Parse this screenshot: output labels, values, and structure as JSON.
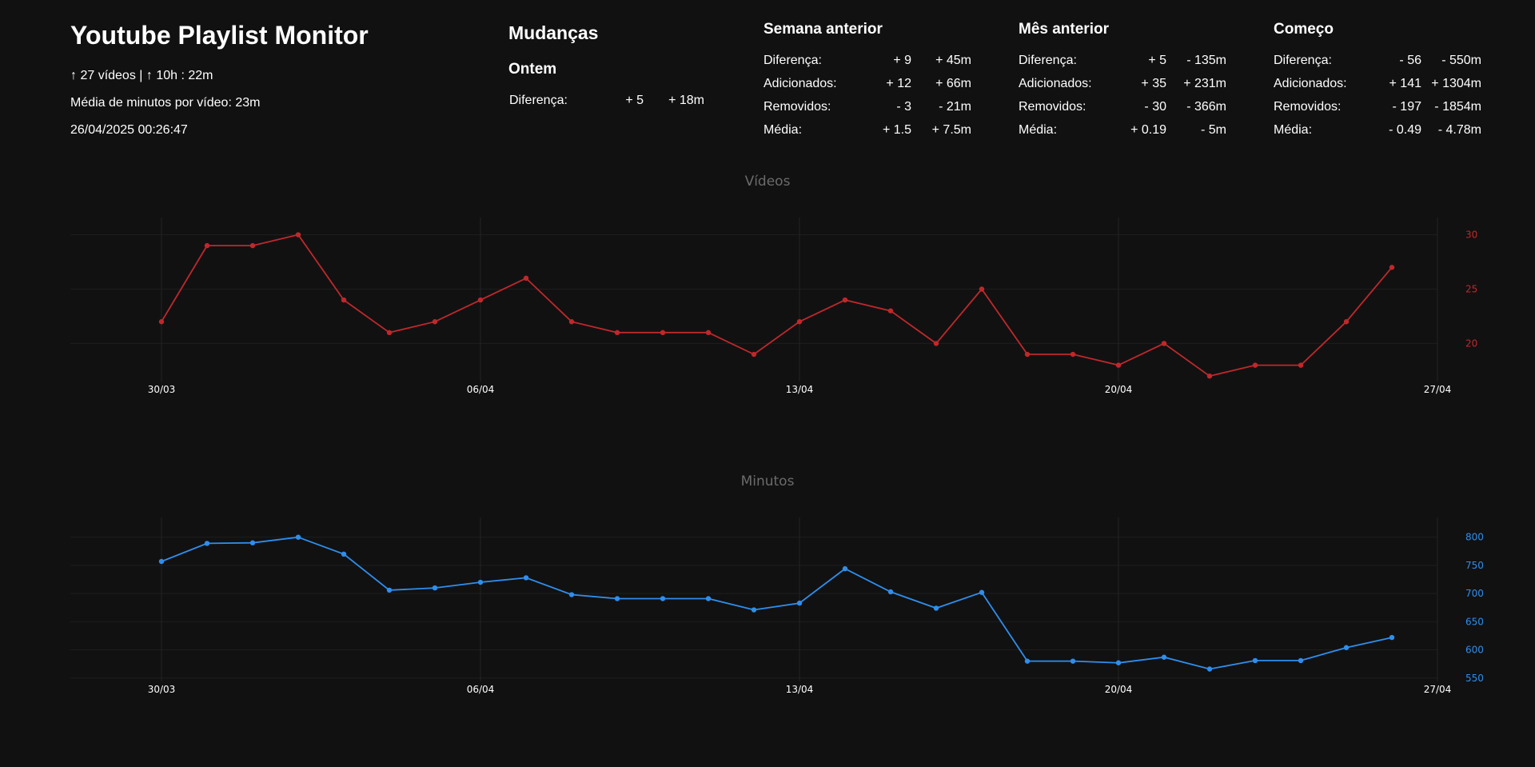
{
  "header": {
    "title": "Youtube Playlist Monitor",
    "summary": "↑ 27 vídeos | ↑ 10h : 22m",
    "average": "Média de minutos por vídeo: 23m",
    "timestamp": "26/04/2025 00:26:47"
  },
  "changes": {
    "title": "Mudanças",
    "yesterday": {
      "title": "Ontem",
      "rows": [
        {
          "label": "Diferença:",
          "count": "+ 5",
          "minutes": "+ 18m"
        }
      ]
    },
    "last_week": {
      "title": "Semana anterior",
      "rows": [
        {
          "label": "Diferença:",
          "count": "+ 9",
          "minutes": "+ 45m"
        },
        {
          "label": "Adicionados:",
          "count": "+ 12",
          "minutes": "+ 66m"
        },
        {
          "label": "Removidos:",
          "count": "- 3",
          "minutes": "- 21m"
        },
        {
          "label": "Média:",
          "count": "+ 1.5",
          "minutes": "+ 7.5m"
        }
      ]
    },
    "last_month": {
      "title": "Mês anterior",
      "rows": [
        {
          "label": "Diferença:",
          "count": "+ 5",
          "minutes": "- 135m"
        },
        {
          "label": "Adicionados:",
          "count": "+ 35",
          "minutes": "+ 231m"
        },
        {
          "label": "Removidos:",
          "count": "- 30",
          "minutes": "- 366m"
        },
        {
          "label": "Média:",
          "count": "+ 0.19",
          "minutes": "- 5m"
        }
      ]
    },
    "start": {
      "title": "Começo",
      "rows": [
        {
          "label": "Diferença:",
          "count": "- 56",
          "minutes": "- 550m"
        },
        {
          "label": "Adicionados:",
          "count": "+ 141",
          "minutes": "+ 1304m"
        },
        {
          "label": "Removidos:",
          "count": "- 197",
          "minutes": "- 1854m"
        },
        {
          "label": "Média:",
          "count": "- 0.49",
          "minutes": "- 4.78m"
        }
      ]
    }
  },
  "chart_data": [
    {
      "type": "line",
      "title": "Vídeos",
      "color": "#c0282b",
      "x": [
        "2025-03-30",
        "2025-03-31",
        "2025-04-01",
        "2025-04-02",
        "2025-04-03",
        "2025-04-04",
        "2025-04-05",
        "2025-04-06",
        "2025-04-07",
        "2025-04-08",
        "2025-04-09",
        "2025-04-10",
        "2025-04-11",
        "2025-04-12",
        "2025-04-13",
        "2025-04-14",
        "2025-04-15",
        "2025-04-16",
        "2025-04-17",
        "2025-04-18",
        "2025-04-19",
        "2025-04-20",
        "2025-04-21",
        "2025-04-22",
        "2025-04-23",
        "2025-04-24",
        "2025-04-25",
        "2025-04-26"
      ],
      "y": [
        22,
        29,
        29,
        30,
        24,
        21,
        22,
        24,
        26,
        22,
        21,
        21,
        21,
        19,
        22,
        24,
        23,
        20,
        25,
        19,
        19,
        18,
        20,
        17,
        18,
        18,
        22,
        27
      ],
      "xticks": [
        "30/03",
        "06/04",
        "13/04",
        "20/04",
        "27/04"
      ],
      "xtick_dates": [
        "2025-03-30",
        "2025-04-06",
        "2025-04-13",
        "2025-04-20",
        "2025-04-27"
      ],
      "xlim": [
        "2025-03-28",
        "2025-04-27"
      ],
      "yticks": [
        20,
        25,
        30
      ],
      "ylim": [
        16.5,
        30.7
      ],
      "y_axis_side": "right",
      "grid": true
    },
    {
      "type": "line",
      "title": "Minutos",
      "color": "#2f8eec",
      "x": [
        "2025-03-30",
        "2025-03-31",
        "2025-04-01",
        "2025-04-02",
        "2025-04-03",
        "2025-04-04",
        "2025-04-05",
        "2025-04-06",
        "2025-04-07",
        "2025-04-08",
        "2025-04-09",
        "2025-04-10",
        "2025-04-11",
        "2025-04-12",
        "2025-04-13",
        "2025-04-14",
        "2025-04-15",
        "2025-04-16",
        "2025-04-17",
        "2025-04-18",
        "2025-04-19",
        "2025-04-20",
        "2025-04-21",
        "2025-04-22",
        "2025-04-23",
        "2025-04-24",
        "2025-04-25",
        "2025-04-26"
      ],
      "y": [
        757,
        789,
        790,
        800,
        770,
        706,
        710,
        720,
        728,
        698,
        691,
        691,
        691,
        671,
        683,
        744,
        703,
        674,
        702,
        580,
        580,
        577,
        587,
        566,
        581,
        581,
        604,
        622
      ],
      "xticks": [
        "30/03",
        "06/04",
        "13/04",
        "20/04",
        "27/04"
      ],
      "xtick_dates": [
        "2025-03-30",
        "2025-04-06",
        "2025-04-13",
        "2025-04-20",
        "2025-04-27"
      ],
      "xlim": [
        "2025-03-28",
        "2025-04-27"
      ],
      "yticks": [
        550,
        600,
        650,
        700,
        750,
        800
      ],
      "ylim": [
        544,
        818
      ],
      "y_axis_side": "right",
      "grid": true
    }
  ]
}
